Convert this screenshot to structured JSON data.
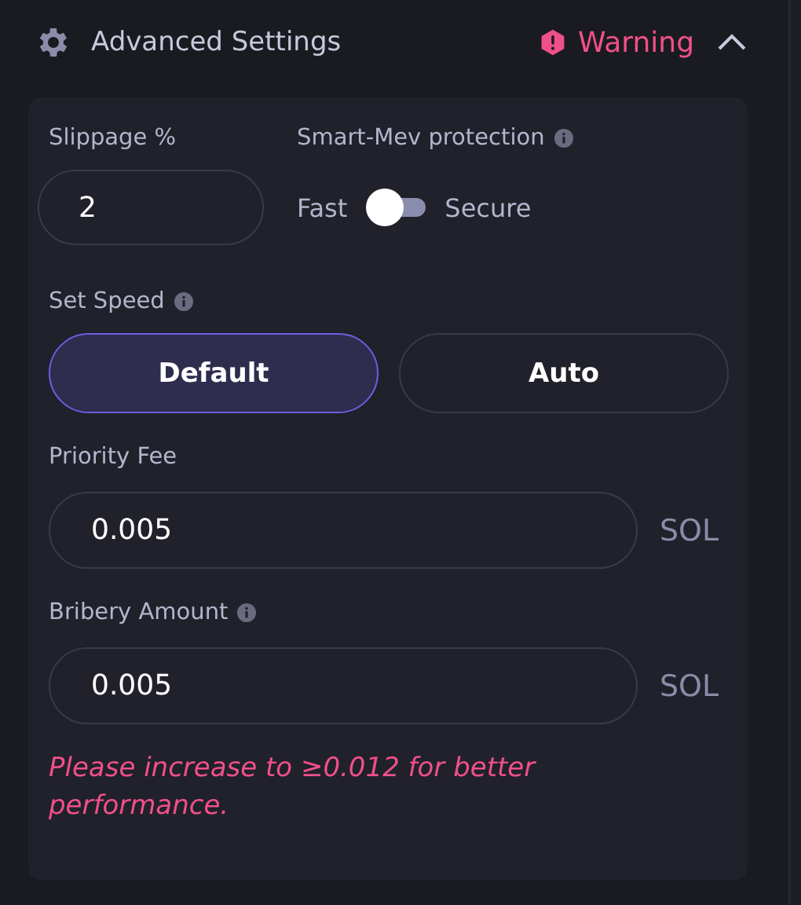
{
  "header": {
    "title": "Advanced Settings",
    "status": "Warning",
    "expanded": true
  },
  "slippage": {
    "label": "Slippage %",
    "value": "2"
  },
  "mev": {
    "label": "Smart-Mev protection",
    "left": "Fast",
    "right": "Secure",
    "on": false
  },
  "speed": {
    "label": "Set Speed",
    "options": [
      {
        "label": "Default",
        "selected": true
      },
      {
        "label": "Auto",
        "selected": false
      }
    ]
  },
  "fields": [
    {
      "label": "Priority Fee",
      "info": false,
      "value": "0.005",
      "unit": "SOL"
    },
    {
      "label": "Bribery Amount",
      "info": true,
      "value": "0.005",
      "unit": "SOL"
    }
  ],
  "warning_text": "Please increase to ≥0.012 for better performance."
}
